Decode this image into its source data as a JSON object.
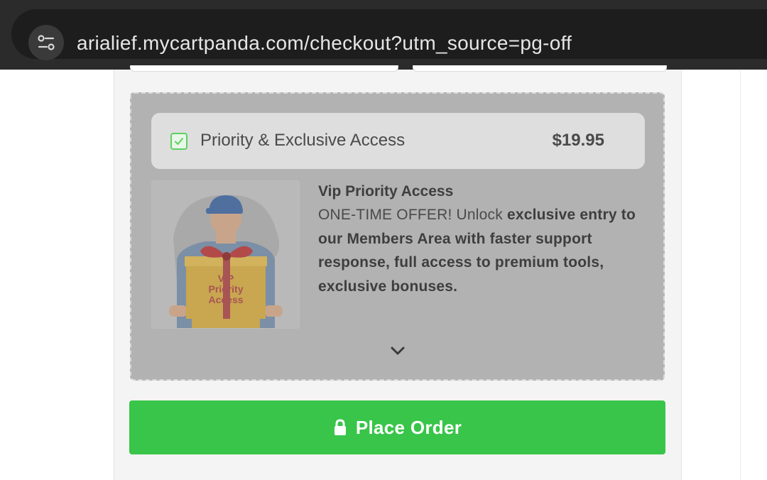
{
  "browser": {
    "url": "arialief.mycartpanda.com/checkout?utm_source=pg-off",
    "site_info_icon": "tune-icon"
  },
  "upsell": {
    "checked": true,
    "title": "Priority & Exclusive Access",
    "price": "$19.95",
    "image_text": [
      "VIP",
      "Priority",
      "Access"
    ],
    "product_name": "Vip Priority Access",
    "desc_lead": "ONE-TIME OFFER! Unlock ",
    "desc_bold": "exclusive entry to our Members Area with faster support response, full access to premium tools, exclusive bonuses.",
    "expand_icon": "chevron-down-icon"
  },
  "checkout": {
    "place_order_label": "Place Order",
    "place_order_icon": "lock-icon",
    "colors": {
      "accent": "#38c549",
      "checkbox": "#5fcf63"
    }
  }
}
